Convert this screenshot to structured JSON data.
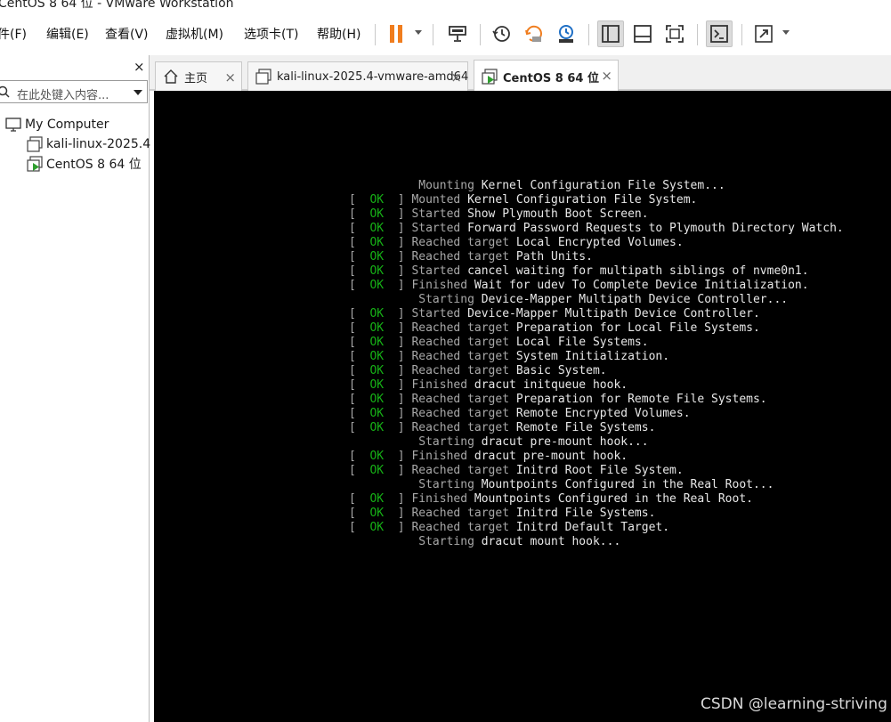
{
  "window": {
    "title": "CentOS 8 64 位 - VMware Workstation"
  },
  "menu": [
    "件(F)",
    "编辑(E)",
    "查看(V)",
    "虚拟机(M)",
    "选项卡(T)",
    "帮助(H)"
  ],
  "toolbar": {
    "icons": [
      "pause-icon",
      "send-ctrl-alt-del-icon",
      "snapshot-icon",
      "revert-snapshot-icon",
      "snapshot-manager-icon",
      "library-view-icon",
      "thumbnail-bar-icon",
      "full-screen-icon",
      "console-view-icon",
      "stretch-guest-icon"
    ]
  },
  "sidebar": {
    "close": "×",
    "search_placeholder": "在此处键入内容...",
    "tree": [
      {
        "label": "My Computer",
        "icon": "computer-icon"
      },
      {
        "label": "kali-linux-2025.4",
        "icon": "vm-icon"
      },
      {
        "label": "CentOS 8 64 位",
        "icon": "vm-running-icon"
      }
    ]
  },
  "tabs": [
    {
      "label": "主页",
      "icon": "home-icon",
      "close": "×"
    },
    {
      "label": "kali-linux-2025.4-vmware-amd64",
      "icon": "vm-icon",
      "close": "×"
    },
    {
      "label": "CentOS 8 64 位",
      "icon": "vm-running-icon",
      "close": "×"
    }
  ],
  "console": {
    "lines": [
      {
        "status": "",
        "verb": "Mounting",
        "text": "Kernel Configuration File System..."
      },
      {
        "status": "OK",
        "verb": "Mounted",
        "text": "Kernel Configuration File System."
      },
      {
        "status": "OK",
        "verb": "Started",
        "text": "Show Plymouth Boot Screen."
      },
      {
        "status": "OK",
        "verb": "Started",
        "text": "Forward Password Requests to Plymouth Directory Watch."
      },
      {
        "status": "OK",
        "verb": "Reached target",
        "text": "Local Encrypted Volumes."
      },
      {
        "status": "OK",
        "verb": "Reached target",
        "text": "Path Units."
      },
      {
        "status": "OK",
        "verb": "Started",
        "text": "cancel waiting for multipath siblings of nvme0n1."
      },
      {
        "status": "OK",
        "verb": "Finished",
        "text": "Wait for udev To Complete Device Initialization."
      },
      {
        "status": "",
        "verb": "Starting",
        "text": "Device-Mapper Multipath Device Controller..."
      },
      {
        "status": "OK",
        "verb": "Started",
        "text": "Device-Mapper Multipath Device Controller."
      },
      {
        "status": "OK",
        "verb": "Reached target",
        "text": "Preparation for Local File Systems."
      },
      {
        "status": "OK",
        "verb": "Reached target",
        "text": "Local File Systems."
      },
      {
        "status": "OK",
        "verb": "Reached target",
        "text": "System Initialization."
      },
      {
        "status": "OK",
        "verb": "Reached target",
        "text": "Basic System."
      },
      {
        "status": "OK",
        "verb": "Finished",
        "text": "dracut initqueue hook."
      },
      {
        "status": "OK",
        "verb": "Reached target",
        "text": "Preparation for Remote File Systems."
      },
      {
        "status": "OK",
        "verb": "Reached target",
        "text": "Remote Encrypted Volumes."
      },
      {
        "status": "OK",
        "verb": "Reached target",
        "text": "Remote File Systems."
      },
      {
        "status": "",
        "verb": "Starting",
        "text": "dracut pre-mount hook..."
      },
      {
        "status": "OK",
        "verb": "Finished",
        "text": "dracut pre-mount hook."
      },
      {
        "status": "OK",
        "verb": "Reached target",
        "text": "Initrd Root File System."
      },
      {
        "status": "",
        "verb": "Starting",
        "text": "Mountpoints Configured in the Real Root..."
      },
      {
        "status": "OK",
        "verb": "Finished",
        "text": "Mountpoints Configured in the Real Root."
      },
      {
        "status": "OK",
        "verb": "Reached target",
        "text": "Initrd File Systems."
      },
      {
        "status": "OK",
        "verb": "Reached target",
        "text": "Initrd Default Target."
      },
      {
        "status": "",
        "verb": "Starting",
        "text": "dracut mount hook..."
      }
    ]
  },
  "watermark": "CSDN @learning-striving",
  "colors": {
    "ok_green": "#16b116",
    "console_bg": "#000000",
    "pause_orange": "#f07d1e"
  }
}
